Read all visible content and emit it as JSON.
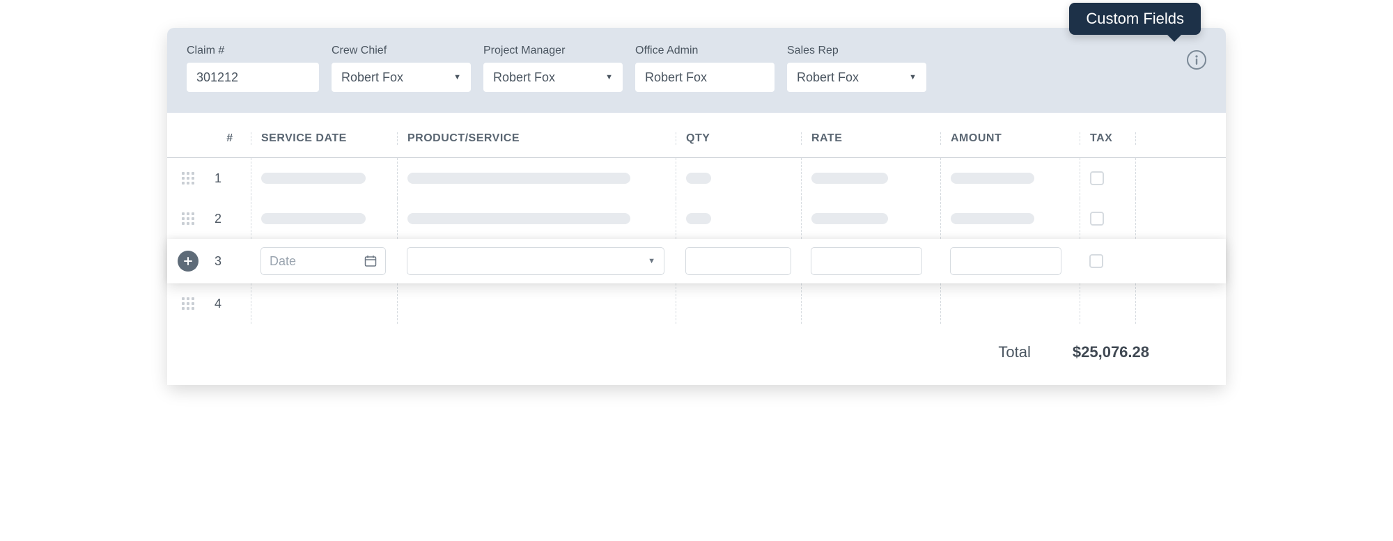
{
  "tooltip_label": "Custom Fields",
  "custom_fields": [
    {
      "key": "claim",
      "label": "Claim #",
      "value": "301212",
      "type": "input"
    },
    {
      "key": "crew_chief",
      "label": "Crew Chief",
      "value": "Robert Fox",
      "type": "select"
    },
    {
      "key": "project_manager",
      "label": "Project Manager",
      "value": "Robert Fox",
      "type": "select"
    },
    {
      "key": "office_admin",
      "label": "Office Admin",
      "value": "Robert Fox",
      "type": "input"
    },
    {
      "key": "sales_rep",
      "label": "Sales Rep",
      "value": "Robert Fox",
      "type": "select"
    }
  ],
  "columns": {
    "num": "#",
    "service_date": "SERVICE DATE",
    "product": "PRODUCT/SERVICE",
    "qty": "QTY",
    "rate": "RATE",
    "amount": "AMOUNT",
    "tax": "TAX"
  },
  "rows": [
    {
      "num": "1"
    },
    {
      "num": "2"
    },
    {
      "num": "3",
      "active": true,
      "date_placeholder": "Date"
    },
    {
      "num": "4"
    }
  ],
  "footer": {
    "total_label": "Total",
    "total_amount": "$25,076.28"
  }
}
